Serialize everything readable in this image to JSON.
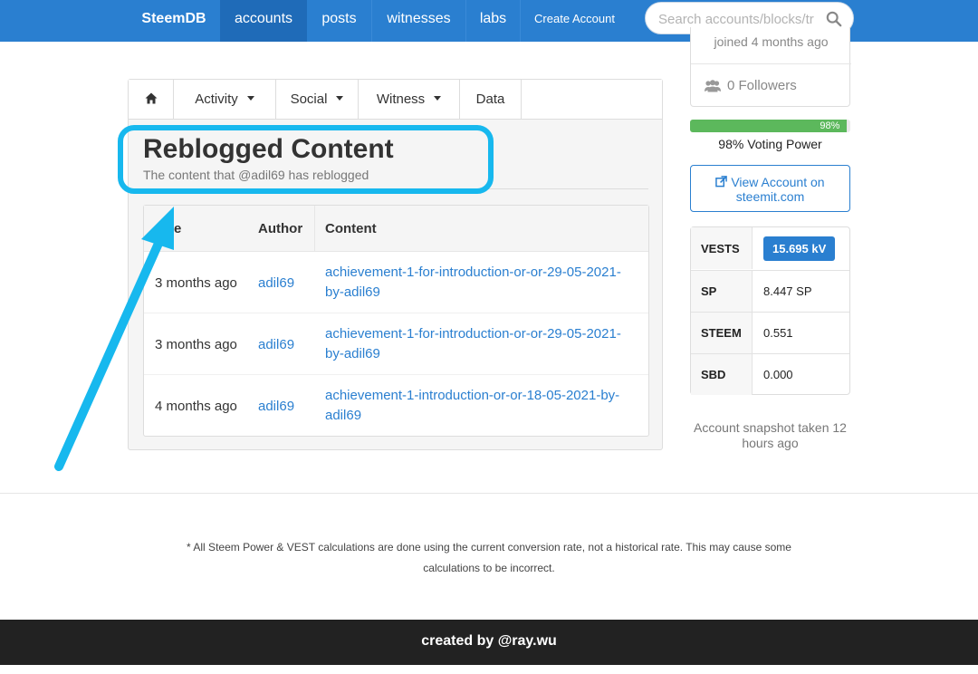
{
  "nav": {
    "brand": "SteemDB",
    "items": [
      "accounts",
      "posts",
      "witnesses",
      "labs",
      "Create Account"
    ],
    "active": "accounts",
    "search_placeholder": "Search accounts/blocks/tr"
  },
  "sidebar": {
    "joined_text": "joined 4 months ago",
    "followers_text": "0 Followers",
    "voting_power_percent": 98,
    "voting_power_label": "98%",
    "voting_power_text": "98% Voting Power",
    "view_account_line1": "View Account on",
    "view_account_line2": "steemit.com",
    "stats": [
      {
        "key": "VESTS",
        "value": "15.695 kV"
      },
      {
        "key": "SP",
        "value": "8.447 SP"
      },
      {
        "key": "STEEM",
        "value": "0.551"
      },
      {
        "key": "SBD",
        "value": "0.000"
      }
    ],
    "snapshot_text": "Account snapshot taken 12 hours ago"
  },
  "tabs": [
    "Activity",
    "Social",
    "Witness",
    "Data"
  ],
  "section": {
    "title": "Reblogged Content",
    "subtitle": "The content that @adil69 has reblogged"
  },
  "table": {
    "headers": [
      "te",
      "Author",
      "Content"
    ],
    "rows": [
      {
        "date": "3 months ago",
        "author": "adil69",
        "content": "achievement-1-for-introduction-or-or-29-05-2021-by-adil69"
      },
      {
        "date": "3 months ago",
        "author": "adil69",
        "content": "achievement-1-for-introduction-or-or-29-05-2021-by-adil69"
      },
      {
        "date": "4 months ago",
        "author": "adil69",
        "content": "achievement-1-introduction-or-or-18-05-2021-by-adil69"
      }
    ]
  },
  "footer": {
    "note": "* All Steem Power & VEST calculations are done using the current conversion rate, not a historical rate. This may cause some calculations to be incorrect.",
    "credit": "created by @ray.wu"
  },
  "colors": {
    "nav_blue": "#2a7fd0",
    "highlight_cyan": "#17b8ee",
    "progress_green": "#5cb85c"
  },
  "icons": [
    "home-icon",
    "search-icon",
    "users-icon",
    "external-link-icon",
    "arrow-annotation"
  ]
}
